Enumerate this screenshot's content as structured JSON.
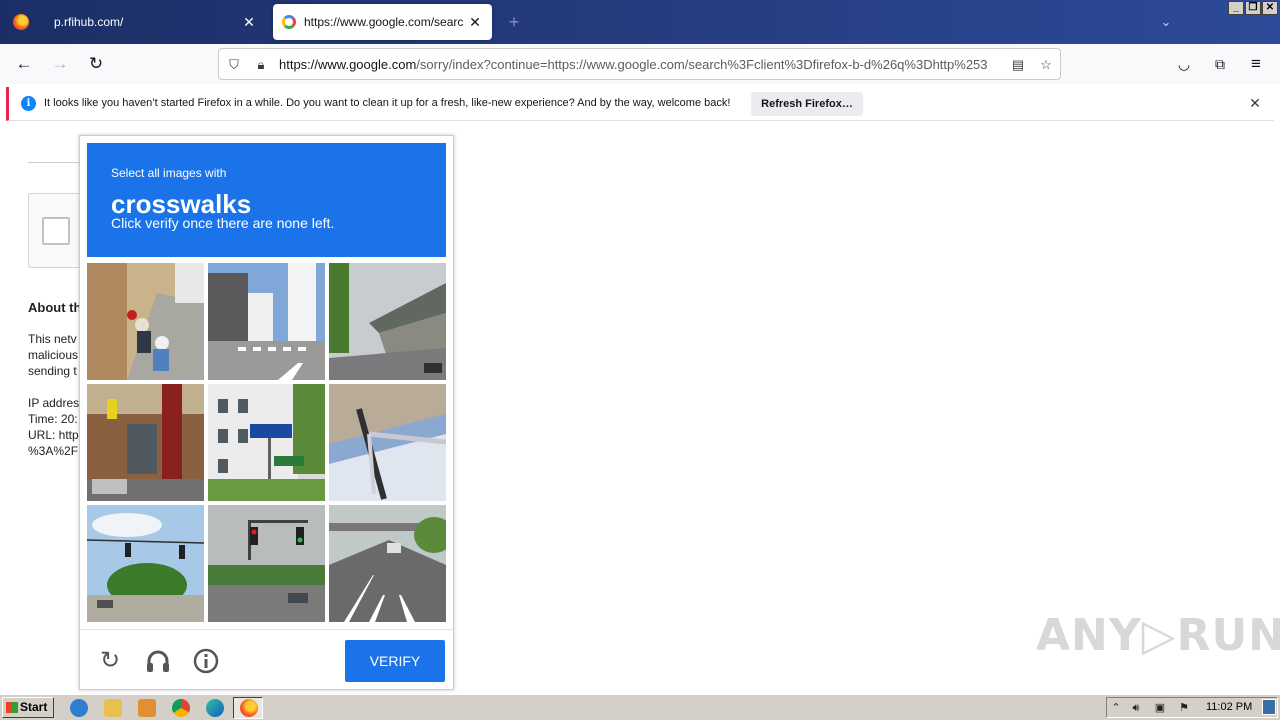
{
  "browser": {
    "tabs": [
      {
        "title": "p.rfihub.com/",
        "active": false
      },
      {
        "title": "https://www.google.com/search?client=firefox-b-d&q=http",
        "active": true
      }
    ],
    "new_tab_icon": "+",
    "list_tabs_icon": "⌄",
    "window_controls": [
      "_",
      "❐",
      "✕"
    ],
    "url": {
      "host": "https://www.google.com",
      "path": "/sorry/index?continue=https://www.google.com/search%3Fclient%3Dfirefox-b-d%26q%3Dhttp%253"
    }
  },
  "notification": {
    "message": "It looks like you haven’t started Firefox in a while. Do you want to clean it up for a fresh, like-new experience? And by the way, welcome back!",
    "button_label": "Refresh Firefox…",
    "info_glyph": "i",
    "close_glyph": "✕"
  },
  "background_page": {
    "about_heading": "About th",
    "lines": [
      "This netv",
      "malicious",
      "sending t",
      "",
      "IP addres",
      "Time: 20:",
      "URL: http",
      "%3A%2F"
    ]
  },
  "captcha": {
    "instruction_small": "Select all images with",
    "target": "crosswalks",
    "instruction_sub": "Click verify once there are none left.",
    "verify_label": "VERIFY",
    "tiles": [
      {
        "scene": "street-motorcycles"
      },
      {
        "scene": "buildings-crosswalk"
      },
      {
        "scene": "highway-overpass"
      },
      {
        "scene": "storefront"
      },
      {
        "scene": "building-sign"
      },
      {
        "scene": "railing-closeup"
      },
      {
        "scene": "traffic-lights-trees"
      },
      {
        "scene": "traffic-lights-road"
      },
      {
        "scene": "highway-lanes"
      }
    ]
  },
  "watermark": "ANY▷RUN",
  "taskbar": {
    "start_label": "Start",
    "clock": "11:02 PM"
  },
  "colors": {
    "captcha_blue": "#1a73e8",
    "tabstrip": "#23397a",
    "notification_accent": "#e22850"
  }
}
